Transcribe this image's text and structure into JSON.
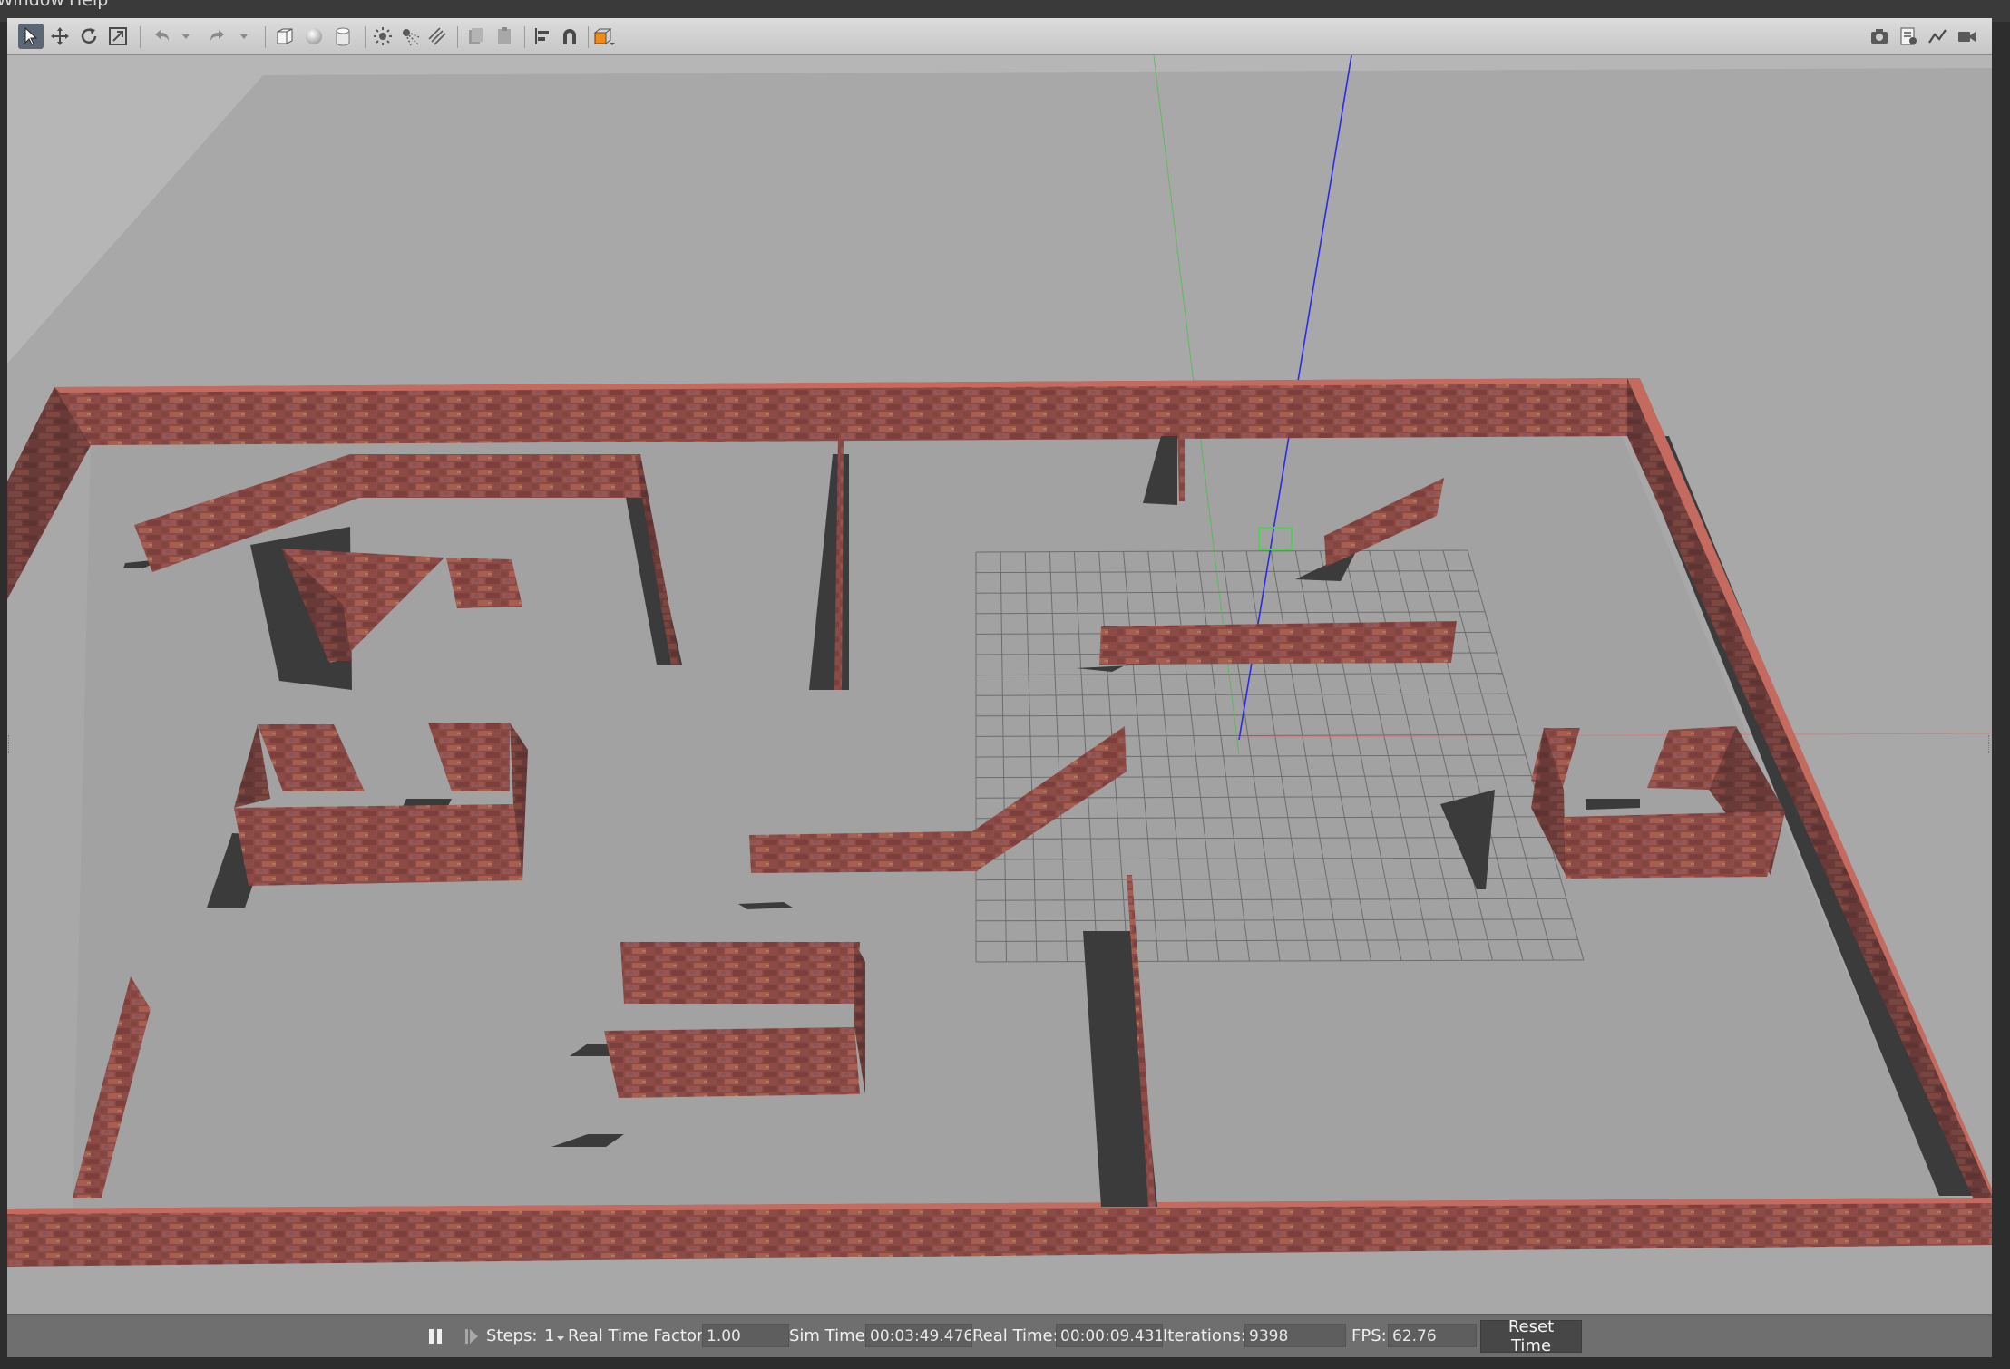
{
  "menu": {
    "items": [
      "Window",
      "Help"
    ]
  },
  "toolbar": {
    "left_tools": [
      "select-mode",
      "translate-mode",
      "rotate-mode",
      "scale-mode",
      "undo",
      "undo-history",
      "redo",
      "redo-history",
      "box-shape",
      "sphere-shape",
      "cylinder-shape",
      "point-light",
      "spot-light",
      "directional-light",
      "copy",
      "paste",
      "align",
      "snap",
      "change-view"
    ],
    "right_tools": [
      "screenshot",
      "log-data",
      "plot",
      "record-video"
    ]
  },
  "status": {
    "steps_label": "Steps:",
    "steps_value": "1",
    "rtf_label": "Real Time Factor:",
    "rtf_value": "1.00",
    "sim_time_label": "Sim Time:",
    "sim_time_value": "00:03:49.476",
    "real_time_label": "Real Time:",
    "real_time_value": "00:00:09.431",
    "iterations_label": "Iterations:",
    "iterations_value": "9398",
    "fps_label": "FPS:",
    "fps_value": "62.76",
    "reset_label": "Reset Time"
  },
  "colors": {
    "ground": "#a6a6a6",
    "wall": "#8a4a44",
    "wall_top": "#c46a5e",
    "shadow": "#3b3b3b",
    "grid": "#6a6a6a",
    "axis_x": "#e06060",
    "axis_y": "#50c050",
    "axis_z": "#3030e0"
  }
}
